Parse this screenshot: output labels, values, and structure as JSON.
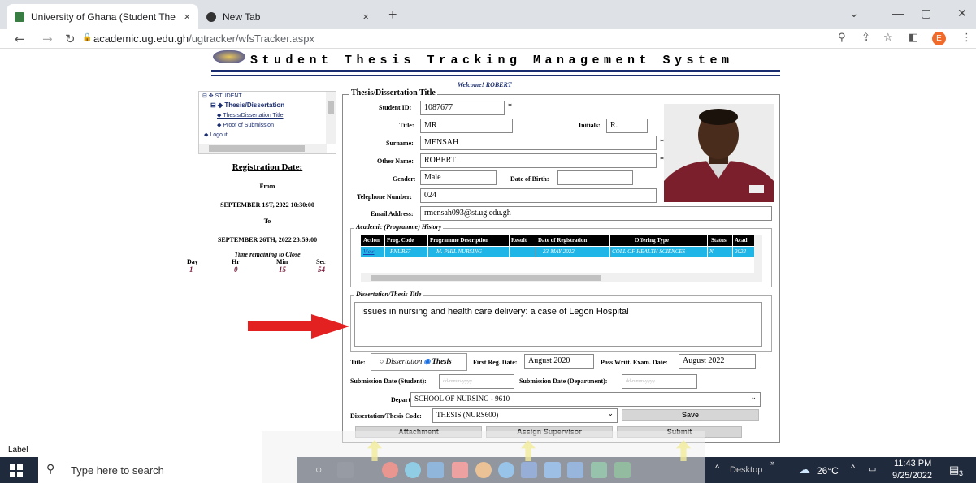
{
  "browser": {
    "tabs": [
      {
        "title": "University of Ghana (Student The",
        "close": "×"
      },
      {
        "title": "New Tab",
        "close": "×"
      }
    ],
    "new_tab": "+",
    "url_host": "academic.ug.edu.gh",
    "url_path": "/ugtracker/wfsTracker.aspx",
    "profile_initial": "E"
  },
  "header": {
    "title": "Student Thesis Tracking Management System",
    "welcome": "Welcome! ROBERT"
  },
  "tree": {
    "root": "STUDENT",
    "group": "Thesis/Dissertation",
    "item1": "Thesis/Dissertation Title",
    "item2": "Proof of Submission",
    "logout": "Logout"
  },
  "registration": {
    "heading": "Registration Date:",
    "from_label": "From",
    "from": "SEPTEMBER 1ST, 2022 10:30:00",
    "to_label": "To",
    "to": "SEPTEMBER 26TH, 2022 23:59:00",
    "remaining_label": "Time remaining to Close",
    "units": [
      "Day",
      "Hr",
      "Min",
      "Sec"
    ],
    "values": [
      "1",
      "0",
      "15",
      "54"
    ]
  },
  "form": {
    "legend": "Thesis/Dissertation Title",
    "student_id_label": "Student ID:",
    "student_id": "1087677",
    "title_label": "Title:",
    "title": "MR",
    "initials_label": "Initials:",
    "initials": "R.",
    "surname_label": "Surname:",
    "surname": "MENSAH",
    "othername_label": "Other Name:",
    "othername": "ROBERT",
    "gender_label": "Gender:",
    "gender": "Male",
    "dob_label": "Date of Birth:",
    "dob": "",
    "phone_label": "Telephone Number:",
    "phone": "024",
    "email_label": "Email Address:",
    "email": "rmensah093@st.ug.edu.gh",
    "required_mark": "*"
  },
  "academic": {
    "legend": "Academic (Programme) History",
    "headers": [
      "Action",
      "Prog. Code",
      "Programme Description",
      "Result",
      "Date of Registration",
      "Offering Type",
      "Status",
      "Acad"
    ],
    "row": [
      "View",
      "PNURS7",
      "M. PHIL NURSING",
      "",
      "23-MAY-2022",
      "COLL OF HEALTH SCIENCES",
      "N",
      "2022"
    ]
  },
  "dissertation": {
    "legend": "Dissertation/Thesis Title",
    "text": "Issues in nursing and health care delivery: a case of Legon Hospital"
  },
  "bottom": {
    "title_label": "Title:",
    "opt_dissertation": "Dissertation",
    "opt_thesis": "Thesis",
    "first_reg_label": "First Reg. Date:",
    "first_reg": "August 2020",
    "pass_exam_label": "Pass Writt. Exam. Date:",
    "pass_exam": "August 2022",
    "sub_student_label": "Submission Date (Student):",
    "sub_student_ph": "dd-mmm-yyyy",
    "sub_dept_label": "Submission Date (Department):",
    "sub_dept_ph": "dd-mmm-yyyy",
    "dept_label": "Department:",
    "dept": "SCHOOL OF NURSING - 9610",
    "code_label": "Dissertation/Thesis Code:",
    "code": "THESIS (NURS600)",
    "save": "Save",
    "attachment": "Attachment",
    "assign": "Assign Supervisor",
    "submit": "Submit"
  },
  "footer_label": "Label",
  "taskbar": {
    "search": "Type here to search",
    "desktop": "Desktop",
    "weather": "26°C",
    "time": "11:43 PM",
    "date": "9/25/2022",
    "notif": "3"
  }
}
